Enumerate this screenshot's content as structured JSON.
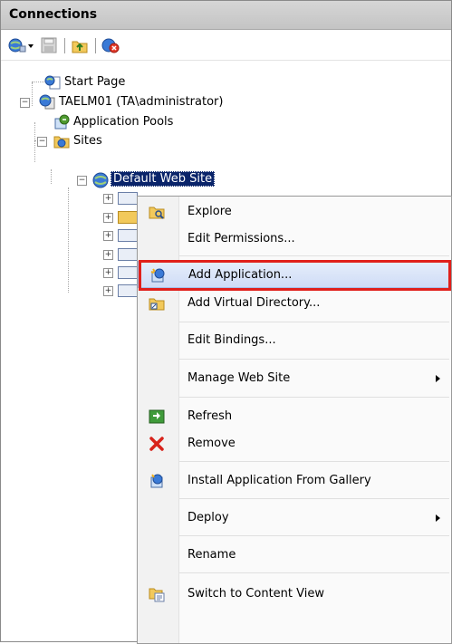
{
  "panel": {
    "title": "Connections"
  },
  "toolbar": {
    "icons": [
      "connect-icon",
      "dropdown-icon",
      "save-icon",
      "up-level-icon",
      "disconnect-icon"
    ]
  },
  "tree": {
    "start_page": "Start Page",
    "server": "TAELM01 (TA\\administrator)",
    "app_pools": "Application Pools",
    "sites": "Sites",
    "default_site": "Default Web Site"
  },
  "context_menu": {
    "items": [
      {
        "label": "Explore",
        "icon": "explore-icon"
      },
      {
        "label": "Edit Permissions...",
        "icon": ""
      },
      {
        "label": "Add Application...",
        "icon": "add-application-icon",
        "highlighted": true
      },
      {
        "label": "Add Virtual Directory...",
        "icon": "add-virtual-directory-icon"
      },
      {
        "label": "Edit Bindings...",
        "icon": ""
      },
      {
        "label": "Manage Web Site",
        "icon": "",
        "submenu": true
      },
      {
        "label": "Refresh",
        "icon": "refresh-icon"
      },
      {
        "label": "Remove",
        "icon": "remove-icon"
      },
      {
        "label": "Install Application From Gallery",
        "icon": "gallery-icon"
      },
      {
        "label": "Deploy",
        "icon": "",
        "submenu": true
      },
      {
        "label": "Rename",
        "icon": ""
      },
      {
        "label": "Switch to Content View",
        "icon": "content-view-icon"
      }
    ]
  },
  "colors": {
    "highlight_border": "#e0201b",
    "selection": "#0a246a"
  }
}
